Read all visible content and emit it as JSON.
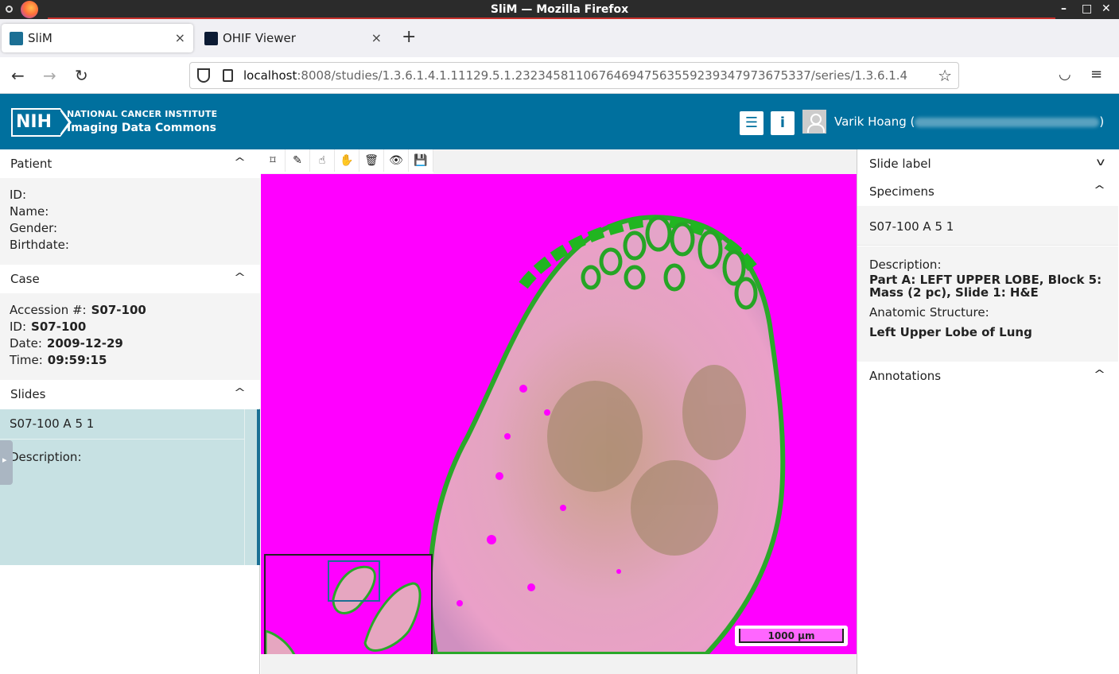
{
  "window": {
    "title": "SliM — Mozilla Firefox"
  },
  "tabs": [
    {
      "label": "SliM",
      "close": "×"
    },
    {
      "label": "OHIF Viewer",
      "close": "×"
    }
  ],
  "newtab": "+",
  "nav": {
    "back": "←",
    "forward": "→",
    "reload": "↻",
    "url_host": "localhost",
    "url_rest": ":8008/studies/1.3.6.1.4.1.11129.5.1.232345811067646947563559239347973675337/series/1.3.6.1.4",
    "star": "☆",
    "pocket": "◡",
    "menu": "≡"
  },
  "header": {
    "logo": "NIH",
    "brand_line1": "NATIONAL CANCER INSTITUTE",
    "brand_line2": "Imaging Data Commons",
    "list_btn": "☰",
    "info_btn": "i",
    "user_name": "Varik Hoang (",
    "user_end": ")"
  },
  "left": {
    "patient": {
      "title": "Patient",
      "id_label": "ID",
      "name_label": "Name",
      "gender_label": "Gender",
      "birthdate_label": "Birthdate"
    },
    "case": {
      "title": "Case",
      "accession_label": "Accession #",
      "accession": "S07-100",
      "id_label": "ID",
      "id": "S07-100",
      "date_label": "Date",
      "date": "2009-12-29",
      "time_label": "Time",
      "time": "09:59:15"
    },
    "slides": {
      "title": "Slides",
      "item": "S07-100 A 5 1",
      "description_label": "Description"
    },
    "chevron": "^"
  },
  "viewer": {
    "tools": [
      "⌑",
      "✎",
      "☝",
      "✋",
      "🗑",
      "👁",
      "💾"
    ],
    "scalebar": "1000 µm"
  },
  "right": {
    "slide_label": "Slide label",
    "specimens": "Specimens",
    "specimen_item": "S07-100 A 5 1",
    "description_label": "Description",
    "description": "Part A: LEFT UPPER LOBE, Block 5: Mass (2 pc), Slide 1: H&E",
    "anatomic_label": "Anatomic Structure",
    "anatomic": "Left Upper Lobe of Lung",
    "annotations": "Annotations",
    "chev_down": "v",
    "chev_up": "^"
  }
}
